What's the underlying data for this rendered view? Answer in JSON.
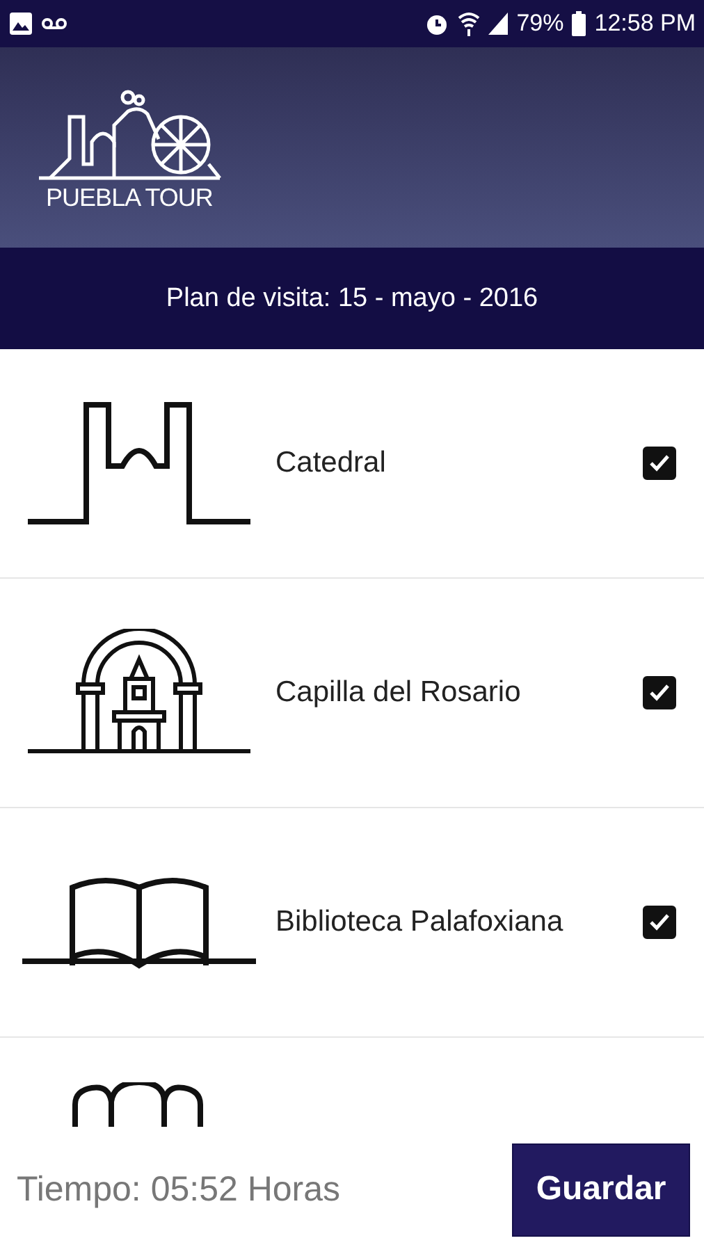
{
  "status_bar": {
    "battery": "79%",
    "time": "12:58 PM"
  },
  "header": {
    "logo_text": "PUEBLA TOUR"
  },
  "plan_title": "Plan de visita: 15 - mayo - 2016",
  "places": [
    {
      "kind": "cathedral",
      "name": "Catedral",
      "checked": true
    },
    {
      "kind": "chapel",
      "name": "Capilla del Rosario",
      "checked": true
    },
    {
      "kind": "book",
      "name": "Biblioteca Palafoxiana",
      "checked": true
    },
    {
      "kind": "arches"
    }
  ],
  "footer": {
    "time_text": "Tiempo: 05:52 Horas",
    "save_button": "Guardar"
  }
}
